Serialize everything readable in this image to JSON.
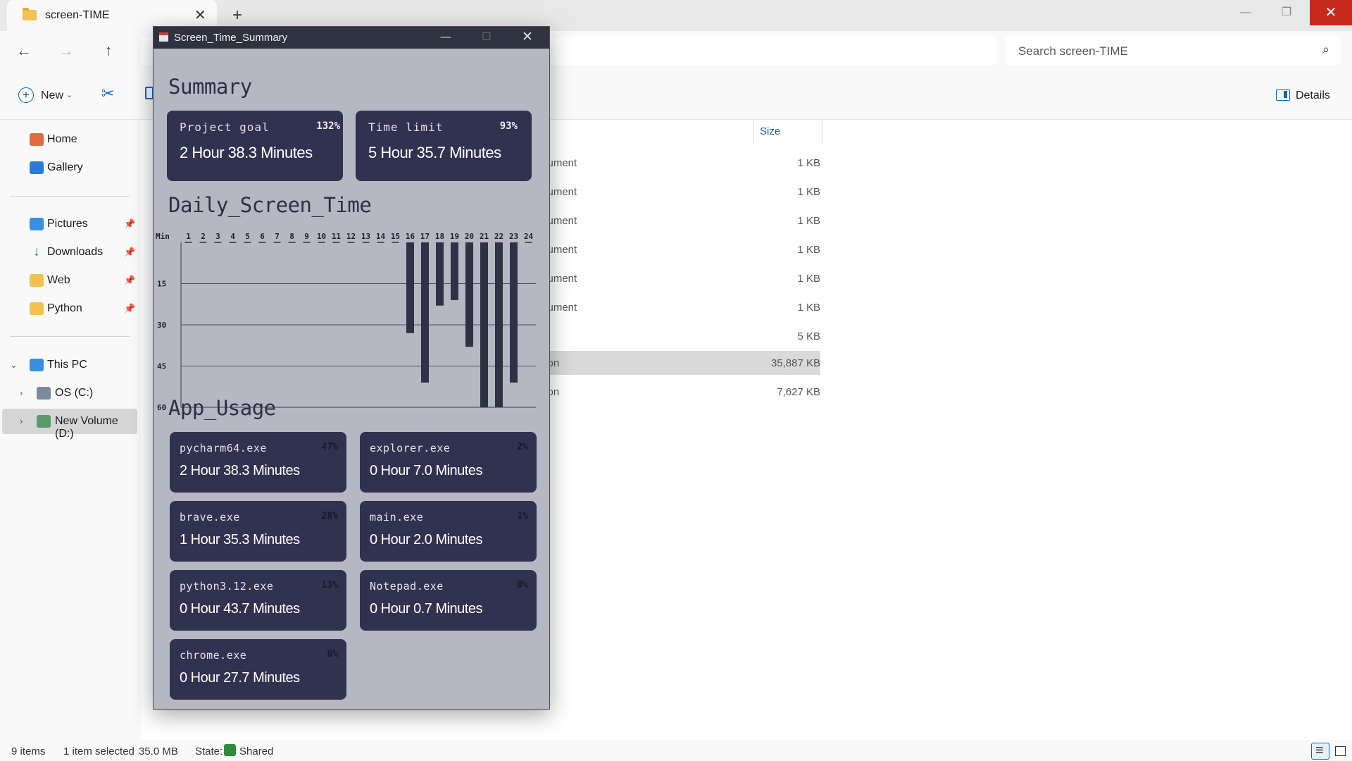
{
  "explorer": {
    "tab_title": "screen-TIME",
    "search_placeholder": "Search screen-TIME",
    "new_label": "New",
    "details_label": "Details",
    "sidebar": {
      "home": "Home",
      "gallery": "Gallery",
      "pictures": "Pictures",
      "downloads": "Downloads",
      "web": "Web",
      "python": "Python",
      "this_pc": "This PC",
      "os_c": "OS (C:)",
      "new_volume": "New Volume (D:)"
    },
    "size_header": "Size",
    "files": [
      {
        "type": "cument",
        "size": "1 KB"
      },
      {
        "type": "cument",
        "size": "1 KB"
      },
      {
        "type": "cument",
        "size": "1 KB"
      },
      {
        "type": "cument",
        "size": "1 KB"
      },
      {
        "type": "cument",
        "size": "1 KB"
      },
      {
        "type": "cument",
        "size": "1 KB"
      },
      {
        "type": "",
        "size": "5 KB"
      },
      {
        "type": "tion",
        "size": "35,887 KB"
      },
      {
        "type": "tion",
        "size": "7,627 KB"
      }
    ],
    "status": {
      "items": "9 items",
      "selected": "1 item selected",
      "selected_size": "35.0 MB",
      "state_label": "State:",
      "state_value": "Shared"
    }
  },
  "app": {
    "window_title": "Screen_Time_Summary",
    "summary_title": "Summary",
    "summary_cards": [
      {
        "name": "Project goal",
        "percent": "132%",
        "value": "2 Hour 38.3 Minutes"
      },
      {
        "name": "Time limit",
        "percent": "93%",
        "value": "5 Hour 35.7 Minutes"
      }
    ],
    "daily_title": "Daily_Screen_Time",
    "app_usage_title": "App_Usage",
    "apps": [
      {
        "name": "pycharm64.exe",
        "percent": "47%",
        "value": "2 Hour 38.3 Minutes"
      },
      {
        "name": "explorer.exe",
        "percent": "2%",
        "value": "0 Hour 7.0 Minutes"
      },
      {
        "name": "brave.exe",
        "percent": "28%",
        "value": "1 Hour 35.3 Minutes"
      },
      {
        "name": "main.exe",
        "percent": "1%",
        "value": "0 Hour 2.0 Minutes"
      },
      {
        "name": "python3.12.exe",
        "percent": "13%",
        "value": "0 Hour 43.7 Minutes"
      },
      {
        "name": "Notepad.exe",
        "percent": "0%",
        "value": "0 Hour 0.7 Minutes"
      },
      {
        "name": "chrome.exe",
        "percent": "8%",
        "value": "0 Hour 27.7 Minutes"
      }
    ]
  },
  "chart_data": {
    "type": "bar",
    "title": "Daily_Screen_Time",
    "ylabel": "Min",
    "categories": [
      "1",
      "2",
      "3",
      "4",
      "5",
      "6",
      "7",
      "8",
      "9",
      "10",
      "11",
      "12",
      "13",
      "14",
      "15",
      "16",
      "17",
      "18",
      "19",
      "20",
      "21",
      "22",
      "23",
      "24"
    ],
    "values": [
      0,
      0,
      0,
      0,
      0,
      0,
      0,
      0,
      0,
      0,
      0,
      0,
      0,
      0,
      0,
      33,
      51,
      23,
      21,
      38,
      60,
      60,
      51,
      0
    ],
    "y_ticks": [
      "15",
      "30",
      "45",
      "60"
    ],
    "ylim": [
      0,
      60
    ],
    "orientation": "bars hang downward from top axis",
    "bar_color": "#2f3145",
    "grid": true
  }
}
